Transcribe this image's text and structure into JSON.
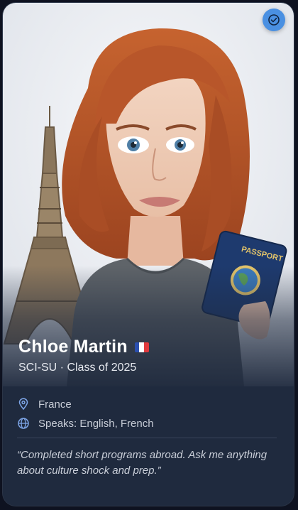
{
  "profile": {
    "name": "Chloe Martin",
    "flag": "French flag",
    "subtitle": "SCI-SU · Class of 2025",
    "location": "France",
    "languages": "Speaks: English, French",
    "quote": "“Completed short programs abroad. Ask me anything about culture shock and prep.”",
    "verify_icon": "check-circle-icon",
    "location_icon": "map-pin-icon",
    "language_icon": "globe-icon"
  },
  "illustration": {
    "passport_text": "PASSPORT"
  },
  "colors": {
    "accent": "#4a90e2",
    "card_bg": "#1f2a3e",
    "hair": "#b8562a",
    "shirt": "#5f6469",
    "passport": "#1e3a6e"
  }
}
